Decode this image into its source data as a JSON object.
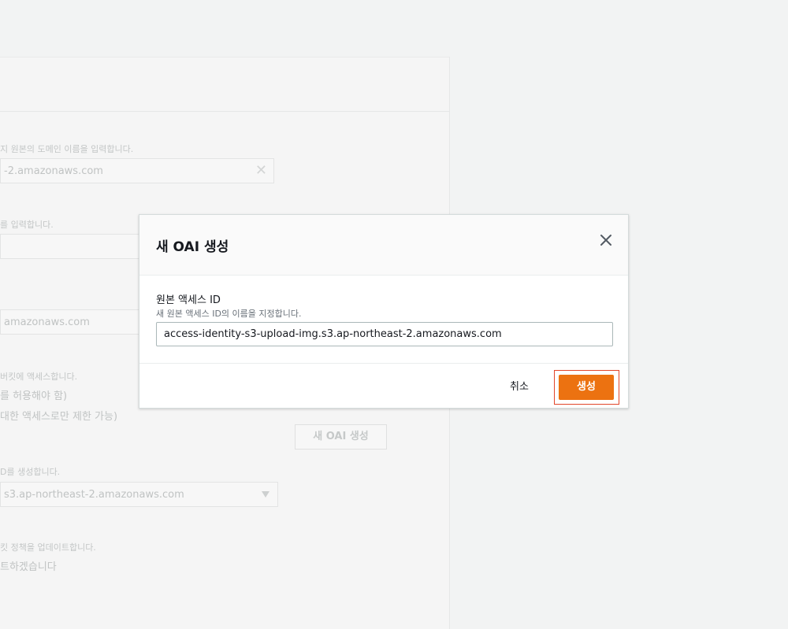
{
  "background": {
    "origin_domain_hint": "지 원본의 도메인 이름을 입력합니다.",
    "origin_domain_value": "-2.amazonaws.com",
    "origin_path_hint": "를 입력합니다.",
    "name_value": "amazonaws.com",
    "bucket_access_hint": "버킷에 액세스합니다.",
    "option_public": "를 허용해야 함)",
    "option_oai": "대한 액세스로만 제한 가능)",
    "oai_hint": "D를 생성합니다.",
    "oai_select_value": "s3.ap-northeast-2.amazonaws.com",
    "new_oai_button": "새 OAI 생성",
    "bucket_policy_hint": "킷 정책을 업데이트합니다.",
    "bucket_policy_value": "트하겠습니다"
  },
  "modal": {
    "title": "새 OAI 생성",
    "field_label": "원본 액세스 ID",
    "field_description": "새 원본 액세스 ID의 이름을 지정합니다.",
    "field_value": "access-identity-s3-upload-img.s3.ap-northeast-2.amazonaws.com",
    "cancel_label": "취소",
    "create_label": "생성"
  },
  "colors": {
    "primary_button": "#ec7211",
    "highlight_border": "#e2462a",
    "text": "#16191f"
  }
}
